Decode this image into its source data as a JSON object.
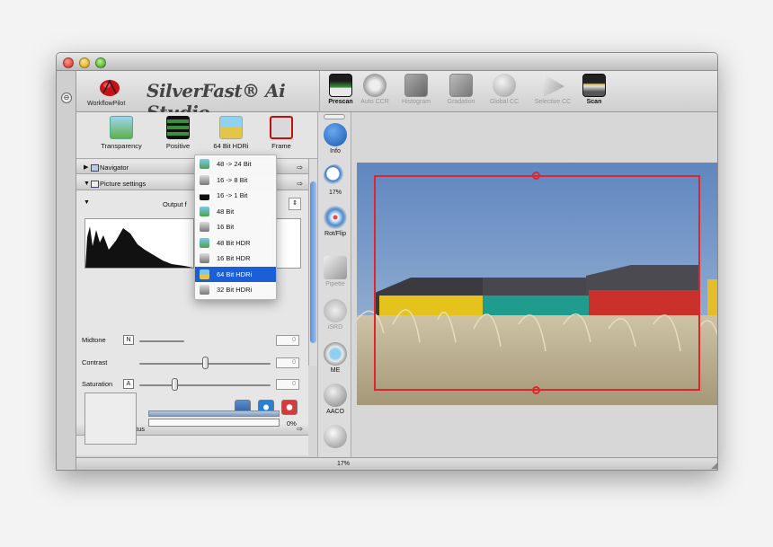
{
  "app": {
    "brand": "SilverFast® Ai Studio",
    "workflow_label": "WorkflowPilot"
  },
  "toolbar": {
    "items": [
      {
        "label": "Prescan",
        "active": true,
        "icon": "prescan-icon"
      },
      {
        "label": "Auto CCR",
        "active": false,
        "icon": "auto-ccr-icon"
      },
      {
        "label": "Histogram",
        "active": false,
        "icon": "histogram-icon"
      },
      {
        "label": "Gradation",
        "active": false,
        "icon": "gradation-icon"
      },
      {
        "label": "Global CC",
        "active": false,
        "icon": "global-cc-icon"
      },
      {
        "label": "Selective CC",
        "active": false,
        "icon": "selective-cc-icon"
      },
      {
        "label": "Scan",
        "active": true,
        "icon": "scan-icon"
      }
    ]
  },
  "modes": [
    {
      "label": "Transparency",
      "icon": "transparency-icon"
    },
    {
      "label": "Positive",
      "icon": "positive-film-icon"
    },
    {
      "label": "64 Bit HDRi",
      "icon": "hdri-icon"
    },
    {
      "label": "Frame",
      "icon": "frame-icon"
    }
  ],
  "panels": {
    "navigator": "Navigator",
    "picture_settings": "Picture settings",
    "output_prefix": "Output f",
    "scanner_status": "Scanner status"
  },
  "sliders": {
    "midtone": {
      "label": "Midtone",
      "letter": "N",
      "value": "0"
    },
    "contrast": {
      "label": "Contrast",
      "value": "0"
    },
    "saturation": {
      "label": "Saturation",
      "letter": "A",
      "value": "0"
    }
  },
  "scanner": {
    "progress_text": "0%",
    "progress": 0
  },
  "dropdown": {
    "items": [
      {
        "label": "48 -> 24 Bit",
        "selected": false
      },
      {
        "label": "16 -> 8 Bit",
        "selected": false
      },
      {
        "label": "16 -> 1 Bit",
        "selected": false
      },
      {
        "label": "48 Bit",
        "selected": false
      },
      {
        "label": "16 Bit",
        "selected": false
      },
      {
        "label": "48 Bit HDR",
        "selected": false
      },
      {
        "label": "16 Bit HDR",
        "selected": false
      },
      {
        "label": "64 Bit HDRi",
        "selected": true
      },
      {
        "label": "32 Bit HDRi",
        "selected": false
      }
    ]
  },
  "tools": [
    {
      "label": "Info",
      "icon": "info-icon",
      "dim": false
    },
    {
      "label": "17%",
      "icon": "zoom-icon",
      "dim": false
    },
    {
      "label": "Rot/Flip",
      "icon": "rotate-flip-icon",
      "dim": false
    },
    {
      "label": "Pipette",
      "icon": "pipette-icon",
      "dim": true
    },
    {
      "label": "iSRD",
      "icon": "isrd-icon",
      "dim": true
    },
    {
      "label": "ME",
      "icon": "multi-exposure-icon",
      "dim": false
    },
    {
      "label": "AACO",
      "icon": "aaco-icon",
      "dim": false
    }
  ],
  "status": {
    "zoom": "17%"
  },
  "colors": {
    "selection": "#1a5fd8",
    "frame": "#e0262a"
  }
}
